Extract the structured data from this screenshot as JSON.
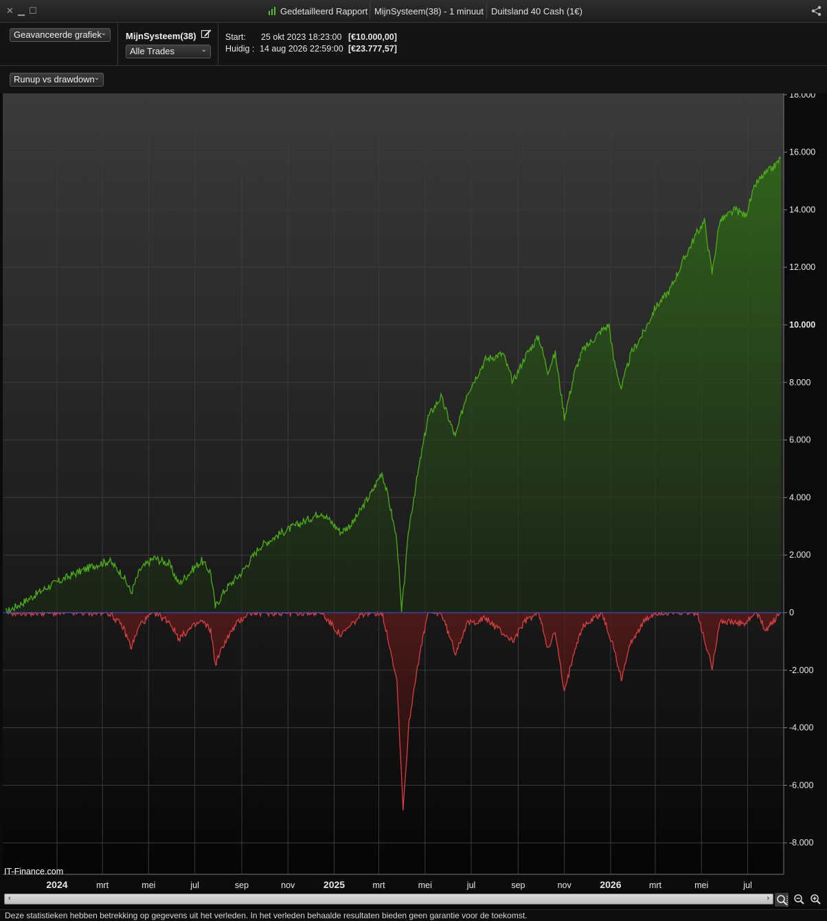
{
  "titlebar": {
    "report_title": "Gedetailleerd Rapport",
    "system_timeframe": "MijnSysteem(38) - 1 minuut",
    "instrument": "Duitsland 40 Cash (1€)",
    "icons": [
      "close-icon",
      "minimize-icon",
      "maximize-icon",
      "report-chart-icon",
      "share-icon"
    ]
  },
  "toolbar": {
    "view_select": "Geavanceerde grafiek",
    "system_name": "MijnSysteem(38)",
    "trades_select": "Alle Trades",
    "start_label": "Start:",
    "start_date": "25 okt 2023 18:23:00",
    "start_value": "[€10.000,00]",
    "current_label": "Huidig :",
    "current_date": "14 aug 2026 22:59:00",
    "current_value": "[€23.777,57]"
  },
  "subbar": {
    "chart_select": "Runup vs drawdown"
  },
  "chart": {
    "watermark": "IT-Finance.com",
    "runup_color": "#4caf16",
    "drawdown_color": "#d94040",
    "zero_line_color": "#3050ff"
  },
  "chart_data": {
    "type": "area",
    "title": "",
    "ylabel": "",
    "xlabel": "",
    "ylim": [
      -9000,
      18000
    ],
    "yticks": [
      18000,
      16000,
      14000,
      12000,
      10000,
      8000,
      6000,
      4000,
      2000,
      0,
      -2000,
      -4000,
      -6000,
      -8000
    ],
    "ytick_labels": [
      "18.000",
      "16.000",
      "14.000",
      "12.000",
      "10.000",
      "8.000",
      "6.000",
      "4.000",
      "2.000",
      "0",
      "-2.000",
      "-4.000",
      "-6.000",
      "-8.000"
    ],
    "xticks": [
      {
        "label": "2024",
        "date": "2024-01-01",
        "bold": true
      },
      {
        "label": "mrt",
        "date": "2024-03-01",
        "bold": false
      },
      {
        "label": "mei",
        "date": "2024-05-01",
        "bold": false
      },
      {
        "label": "jul",
        "date": "2024-07-01",
        "bold": false
      },
      {
        "label": "sep",
        "date": "2024-09-01",
        "bold": false
      },
      {
        "label": "nov",
        "date": "2024-11-01",
        "bold": false
      },
      {
        "label": "2025",
        "date": "2025-01-01",
        "bold": true
      },
      {
        "label": "mrt",
        "date": "2025-03-01",
        "bold": false
      },
      {
        "label": "mei",
        "date": "2025-05-01",
        "bold": false
      },
      {
        "label": "jul",
        "date": "2025-07-01",
        "bold": false
      },
      {
        "label": "sep",
        "date": "2025-09-01",
        "bold": false
      },
      {
        "label": "nov",
        "date": "2025-11-01",
        "bold": false
      },
      {
        "label": "2026",
        "date": "2026-01-01",
        "bold": true
      },
      {
        "label": "mrt",
        "date": "2026-03-01",
        "bold": false
      },
      {
        "label": "mei",
        "date": "2026-05-01",
        "bold": false
      },
      {
        "label": "jul",
        "date": "2026-07-01",
        "bold": false
      }
    ],
    "x_range": [
      "2023-10-25",
      "2026-08-14"
    ],
    "grid": true,
    "series": [
      {
        "name": "",
        "color": "#4caf16",
        "points": [
          [
            "2023-10-25",
            0
          ],
          [
            "2023-11-20",
            400
          ],
          [
            "2023-12-20",
            900
          ],
          [
            "2024-01-20",
            1300
          ],
          [
            "2024-02-20",
            1650
          ],
          [
            "2024-03-10",
            1800
          ],
          [
            "2024-03-28",
            1300
          ],
          [
            "2024-04-08",
            700
          ],
          [
            "2024-04-20",
            1500
          ],
          [
            "2024-05-08",
            1900
          ],
          [
            "2024-05-28",
            1700
          ],
          [
            "2024-06-10",
            1000
          ],
          [
            "2024-06-28",
            1500
          ],
          [
            "2024-07-10",
            1800
          ],
          [
            "2024-07-22",
            1400
          ],
          [
            "2024-07-28",
            200
          ],
          [
            "2024-08-10",
            800
          ],
          [
            "2024-09-01",
            1400
          ],
          [
            "2024-09-25",
            2300
          ],
          [
            "2024-10-25",
            2800
          ],
          [
            "2024-11-25",
            3200
          ],
          [
            "2024-12-15",
            3500
          ],
          [
            "2025-01-10",
            2800
          ],
          [
            "2025-01-25",
            3100
          ],
          [
            "2025-02-20",
            4200
          ],
          [
            "2025-03-05",
            4900
          ],
          [
            "2025-03-15",
            3800
          ],
          [
            "2025-03-25",
            2500
          ],
          [
            "2025-03-31",
            0
          ],
          [
            "2025-04-10",
            3000
          ],
          [
            "2025-04-20",
            4600
          ],
          [
            "2025-05-05",
            6800
          ],
          [
            "2025-05-22",
            7500
          ],
          [
            "2025-06-02",
            6700
          ],
          [
            "2025-06-10",
            6100
          ],
          [
            "2025-06-25",
            7600
          ],
          [
            "2025-07-20",
            8800
          ],
          [
            "2025-08-12",
            9000
          ],
          [
            "2025-08-25",
            8000
          ],
          [
            "2025-09-10",
            8900
          ],
          [
            "2025-09-28",
            9600
          ],
          [
            "2025-10-10",
            8400
          ],
          [
            "2025-10-20",
            9000
          ],
          [
            "2025-11-01",
            6800
          ],
          [
            "2025-11-15",
            8400
          ],
          [
            "2025-11-25",
            9100
          ],
          [
            "2025-12-20",
            9800
          ],
          [
            "2025-12-30",
            10000
          ],
          [
            "2026-01-05",
            8800
          ],
          [
            "2026-01-15",
            7800
          ],
          [
            "2026-01-28",
            9000
          ],
          [
            "2026-02-15",
            9800
          ],
          [
            "2026-03-01",
            10600
          ],
          [
            "2026-03-20",
            11200
          ],
          [
            "2026-04-10",
            12400
          ],
          [
            "2026-04-25",
            13200
          ],
          [
            "2026-05-05",
            13600
          ],
          [
            "2026-05-15",
            11800
          ],
          [
            "2026-05-25",
            13600
          ],
          [
            "2026-06-15",
            14000
          ],
          [
            "2026-06-28",
            13800
          ],
          [
            "2026-07-12",
            14900
          ],
          [
            "2026-07-22",
            15200
          ],
          [
            "2026-08-05",
            15500
          ],
          [
            "2026-08-14",
            15800
          ]
        ]
      },
      {
        "name": "",
        "color": "#d94040",
        "points": [
          [
            "2023-10-25",
            0
          ],
          [
            "2024-03-10",
            0
          ],
          [
            "2024-03-28",
            -500
          ],
          [
            "2024-04-08",
            -1200
          ],
          [
            "2024-04-20",
            -400
          ],
          [
            "2024-05-08",
            0
          ],
          [
            "2024-05-28",
            -300
          ],
          [
            "2024-06-10",
            -900
          ],
          [
            "2024-06-28",
            -500
          ],
          [
            "2024-07-10",
            -300
          ],
          [
            "2024-07-22",
            -600
          ],
          [
            "2024-07-28",
            -1800
          ],
          [
            "2024-08-10",
            -1000
          ],
          [
            "2024-08-25",
            -400
          ],
          [
            "2024-09-10",
            0
          ],
          [
            "2024-12-15",
            0
          ],
          [
            "2025-01-10",
            -800
          ],
          [
            "2025-01-25",
            -400
          ],
          [
            "2025-02-10",
            0
          ],
          [
            "2025-03-05",
            0
          ],
          [
            "2025-03-15",
            -1100
          ],
          [
            "2025-03-25",
            -2400
          ],
          [
            "2025-04-02",
            -6800
          ],
          [
            "2025-04-10",
            -3800
          ],
          [
            "2025-04-20",
            -2000
          ],
          [
            "2025-05-05",
            0
          ],
          [
            "2025-05-22",
            0
          ],
          [
            "2025-06-02",
            -800
          ],
          [
            "2025-06-10",
            -1400
          ],
          [
            "2025-06-25",
            -400
          ],
          [
            "2025-07-20",
            -200
          ],
          [
            "2025-08-25",
            -1000
          ],
          [
            "2025-09-10",
            -300
          ],
          [
            "2025-09-28",
            0
          ],
          [
            "2025-10-10",
            -1200
          ],
          [
            "2025-10-20",
            -700
          ],
          [
            "2025-11-01",
            -2800
          ],
          [
            "2025-11-15",
            -1200
          ],
          [
            "2025-11-25",
            -500
          ],
          [
            "2025-12-20",
            0
          ],
          [
            "2026-01-05",
            -1200
          ],
          [
            "2026-01-15",
            -2300
          ],
          [
            "2026-01-28",
            -1000
          ],
          [
            "2026-02-15",
            -300
          ],
          [
            "2026-03-01",
            0
          ],
          [
            "2026-04-25",
            0
          ],
          [
            "2026-05-15",
            -1900
          ],
          [
            "2026-05-25",
            -300
          ],
          [
            "2026-06-28",
            -400
          ],
          [
            "2026-07-12",
            0
          ],
          [
            "2026-07-25",
            -600
          ],
          [
            "2026-08-14",
            0
          ]
        ]
      }
    ]
  },
  "scrollbar": {
    "left_arrow": "‹",
    "right_arrow": "›"
  },
  "footer": {
    "disclaimer": "Deze statistieken hebben betrekking op gegevens uit het verleden. In het verleden behaalde resultaten bieden geen garantie voor de toekomst."
  }
}
